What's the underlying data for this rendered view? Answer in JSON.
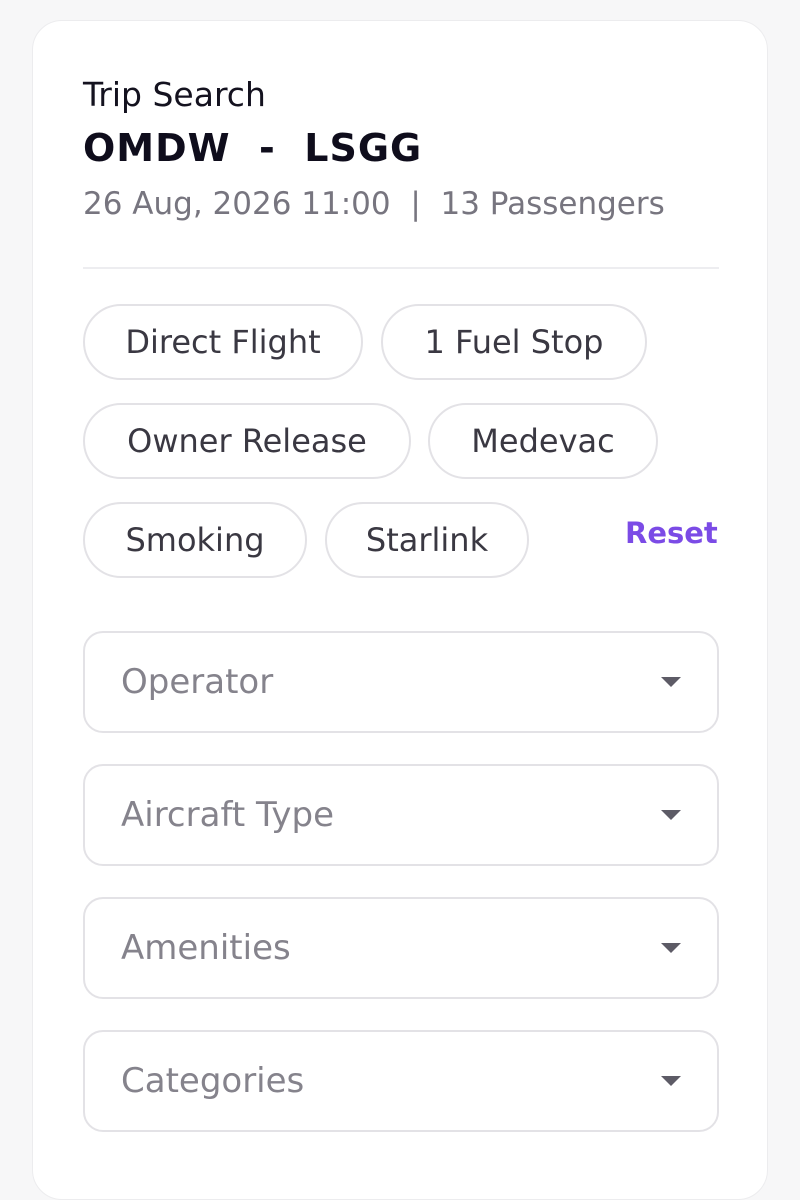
{
  "header": {
    "eyebrow": "Trip Search",
    "route": "OMDW  -  LSGG",
    "meta": "26 Aug, 2026 11:00  |  13 Passengers"
  },
  "filters": {
    "chips": [
      {
        "label": "Direct Flight"
      },
      {
        "label": "1 Fuel Stop"
      },
      {
        "label": "Owner Release"
      },
      {
        "label": "Medevac"
      },
      {
        "label": "Smoking"
      },
      {
        "label": "Starlink"
      }
    ],
    "reset_label": "Reset"
  },
  "dropdowns": [
    {
      "label": "Operator"
    },
    {
      "label": "Aircraft Type"
    },
    {
      "label": "Amenities"
    },
    {
      "label": "Categories"
    }
  ],
  "colors": {
    "accent": "#7b4be6",
    "chip_border": "#e3e2e6",
    "muted_text": "#77757f"
  }
}
